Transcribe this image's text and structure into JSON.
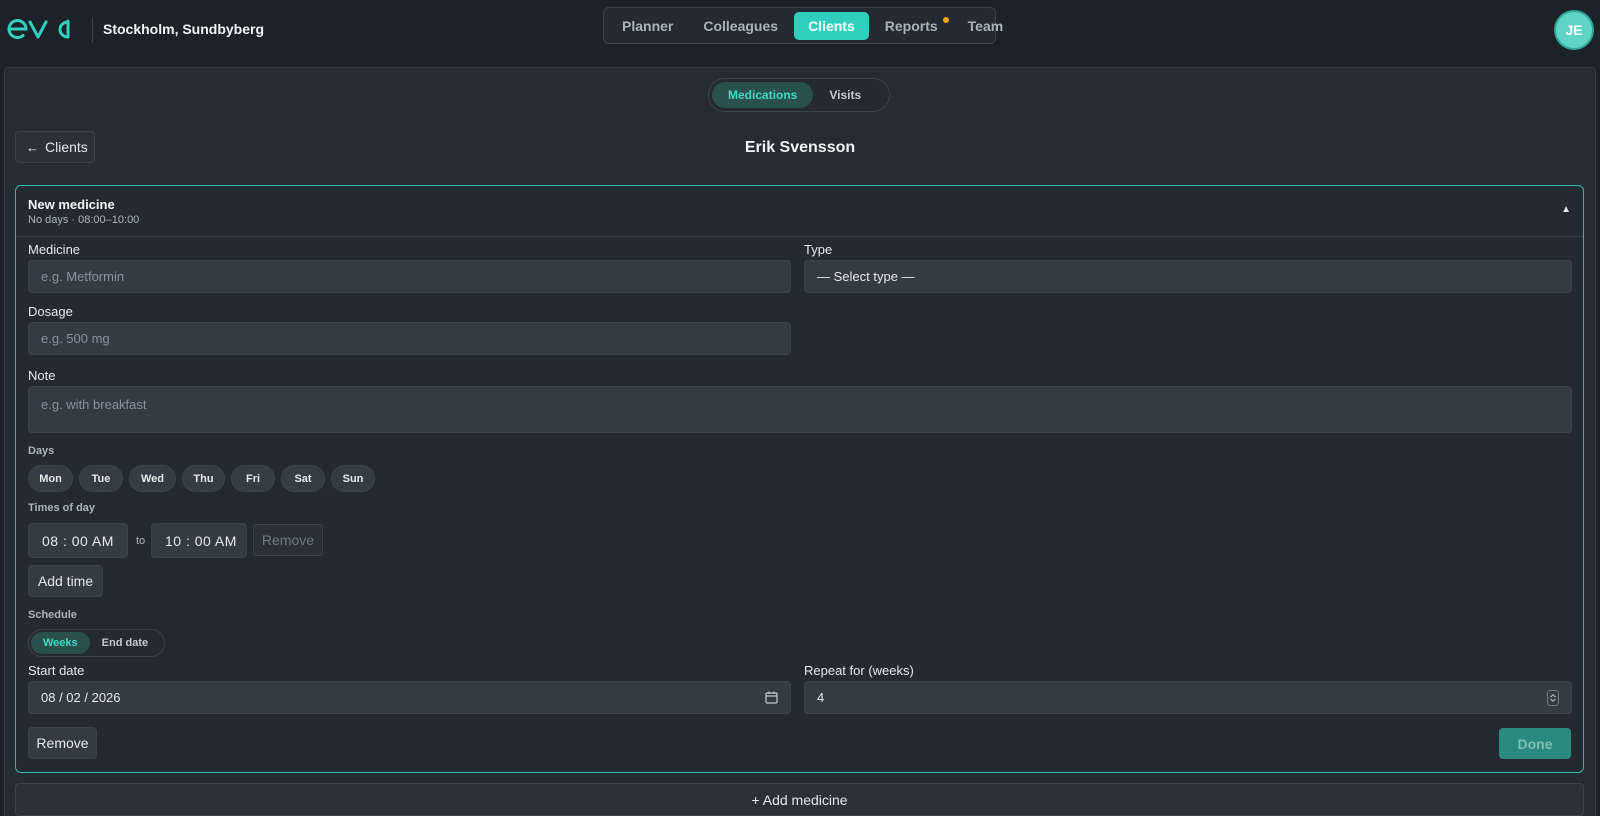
{
  "header": {
    "logo_text": "eva",
    "location": "Stockholm, Sundbyberg",
    "nav": [
      {
        "label": "Planner",
        "active": false
      },
      {
        "label": "Colleagues",
        "active": false
      },
      {
        "label": "Clients",
        "active": true
      },
      {
        "label": "Reports",
        "active": false,
        "notification": true
      },
      {
        "label": "Team",
        "active": false
      }
    ],
    "avatar_initials": "JE"
  },
  "subtabs": [
    {
      "label": "Medications",
      "active": true
    },
    {
      "label": "Visits",
      "active": false
    }
  ],
  "back_button": {
    "label": "Clients",
    "icon": "arrow-left-icon"
  },
  "client_name": "Erik Svensson",
  "card": {
    "title": "New medicine",
    "subtitle": "No days · 08:00–10:00",
    "collapse_icon": "caret-up-icon",
    "medicine": {
      "label": "Medicine",
      "placeholder": "e.g. Metformin"
    },
    "type": {
      "label": "Type",
      "value": "— Select type —"
    },
    "dosage": {
      "label": "Dosage",
      "placeholder": "e.g. 500 mg"
    },
    "note": {
      "label": "Note",
      "placeholder": "e.g. with breakfast"
    },
    "days": {
      "label": "Days",
      "items": [
        "Mon",
        "Tue",
        "Wed",
        "Thu",
        "Fri",
        "Sat",
        "Sun"
      ]
    },
    "times": {
      "label": "Times of day",
      "from": "08 : 00   AM",
      "to_label": "to",
      "to": "10 : 00   AM",
      "remove_label": "Remove",
      "add_label": "Add time"
    },
    "schedule": {
      "label": "Schedule",
      "options": [
        {
          "label": "Weeks",
          "active": true
        },
        {
          "label": "End date",
          "active": false
        }
      ]
    },
    "start_date": {
      "label": "Start date",
      "value": "08 / 02 / 2026"
    },
    "repeat": {
      "label": "Repeat for (weeks)",
      "value": "4"
    },
    "remove_label": "Remove",
    "done_label": "Done"
  },
  "add_medicine_label": "+ Add medicine",
  "colors": {
    "accent": "#2fd1be",
    "background": "#1d2228",
    "panel": "#262c33",
    "notification": "#f5a623"
  }
}
